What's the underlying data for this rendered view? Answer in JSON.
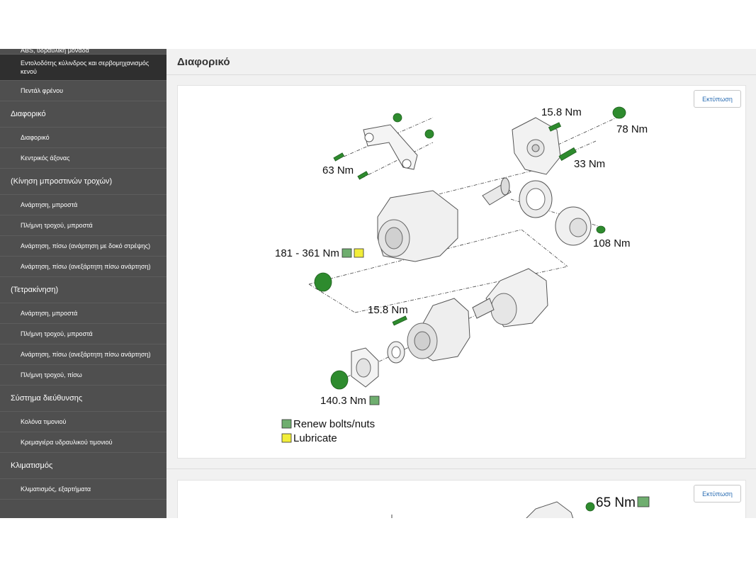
{
  "sidebar": {
    "items": [
      {
        "label": "ABS, υδραυλική μονάδα",
        "level": "sub"
      },
      {
        "label": "Εντολοδότης κύλινδρος και σερβομηχανισμός κενού",
        "level": "sub",
        "active": true
      },
      {
        "label": "Πεντάλ φρένου",
        "level": "sub"
      },
      {
        "label": "Διαφορικό",
        "level": "top"
      },
      {
        "label": "Διαφορικό",
        "level": "sub"
      },
      {
        "label": "Κεντρικός άξονας",
        "level": "sub"
      },
      {
        "label": "(Κίνηση μπροστινών τροχών)",
        "level": "top"
      },
      {
        "label": "Ανάρτηση, μπροστά",
        "level": "sub"
      },
      {
        "label": "Πλήμνη τροχού, μπροστά",
        "level": "sub"
      },
      {
        "label": "Ανάρτηση, πίσω (ανάρτηση με δοκό στρέψης)",
        "level": "sub"
      },
      {
        "label": "Ανάρτηση, πίσω (ανεξάρτητη πίσω ανάρτηση)",
        "level": "sub"
      },
      {
        "label": "(Τετρακίνηση)",
        "level": "top"
      },
      {
        "label": "Ανάρτηση, μπροστά",
        "level": "sub"
      },
      {
        "label": "Πλήμνη τροχού, μπροστά",
        "level": "sub"
      },
      {
        "label": "Ανάρτηση, πίσω (ανεξάρτητη πίσω ανάρτηση)",
        "level": "sub"
      },
      {
        "label": "Πλήμνη τροχού, πίσω",
        "level": "sub"
      },
      {
        "label": "Σύστημα διεύθυνσης",
        "level": "top"
      },
      {
        "label": "Κολόνα τιμονιού",
        "level": "sub"
      },
      {
        "label": "Κρεμαγιέρα υδραυλικού τιμονιού",
        "level": "sub"
      },
      {
        "label": "Κλιματισμός",
        "level": "top"
      },
      {
        "label": "Κλιματισμός, εξαρτήματα",
        "level": "sub"
      }
    ]
  },
  "main": {
    "title": "Διαφορικό",
    "print_label": "Εκτύπωση"
  },
  "diagram1": {
    "torques": {
      "t1": "15.8 Nm",
      "t2": "78 Nm",
      "t3": "33 Nm",
      "t4": "63 Nm",
      "t5": "181 - 361 Nm",
      "t6": "108 Nm",
      "t7": "15.8 Nm",
      "t8": "140.3 Nm"
    },
    "legend": {
      "renew": "Renew bolts/nuts",
      "lubricate": "Lubricate"
    },
    "colors": {
      "renew": "#6fae6f",
      "lubricate": "#f2ee3a",
      "bolt": "#2e8b2e"
    }
  },
  "diagram2": {
    "torques": {
      "t1": "65 Nm"
    }
  }
}
